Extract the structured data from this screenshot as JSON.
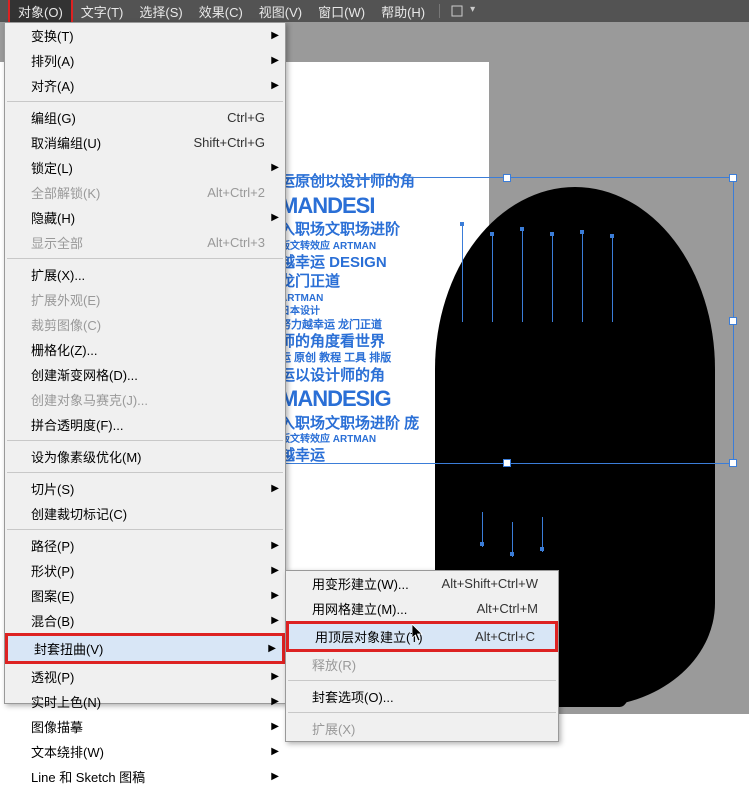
{
  "menubar": {
    "items": [
      "对象(O)",
      "文字(T)",
      "选择(S)",
      "效果(C)",
      "视图(V)",
      "窗口(W)",
      "帮助(H)"
    ]
  },
  "bg_text": {
    "l1": "运原创以设计师的角",
    "l2": "MANDESI",
    "l3": "入职场文职场进阶",
    "l4": "版文转效应 ARTMAN",
    "l5": "越幸运 DESIGN",
    "l6": "龙门正道",
    "l7": "ARTMAN",
    "l8": "日本设计",
    "l9": "努力越幸运 龙门正道",
    "l10": "师的角度看世界",
    "l11": "运 原创 教程 工具 排版",
    "l12": "运以设计师的角",
    "l13": "MANDESIG",
    "l14": "入职场文职场进阶 庞",
    "l15": "版文转效应 ARTMAN",
    "l16": "越幸运"
  },
  "main_menu": [
    {
      "label": "变换(T)",
      "sub": true
    },
    {
      "label": "排列(A)",
      "sub": true
    },
    {
      "label": "对齐(A)",
      "sub": true
    },
    {
      "sep": true
    },
    {
      "label": "编组(G)",
      "sc": "Ctrl+G"
    },
    {
      "label": "取消编组(U)",
      "sc": "Shift+Ctrl+G"
    },
    {
      "label": "锁定(L)",
      "sub": true
    },
    {
      "label": "全部解锁(K)",
      "sc": "Alt+Ctrl+2",
      "disabled": true
    },
    {
      "label": "隐藏(H)",
      "sub": true
    },
    {
      "label": "显示全部",
      "sc": "Alt+Ctrl+3",
      "disabled": true
    },
    {
      "sep": true
    },
    {
      "label": "扩展(X)..."
    },
    {
      "label": "扩展外观(E)",
      "disabled": true
    },
    {
      "label": "裁剪图像(C)",
      "disabled": true
    },
    {
      "label": "栅格化(Z)..."
    },
    {
      "label": "创建渐变网格(D)..."
    },
    {
      "label": "创建对象马赛克(J)...",
      "disabled": true
    },
    {
      "label": "拼合透明度(F)..."
    },
    {
      "sep": true
    },
    {
      "label": "设为像素级优化(M)"
    },
    {
      "sep": true
    },
    {
      "label": "切片(S)",
      "sub": true
    },
    {
      "label": "创建裁切标记(C)"
    },
    {
      "sep": true
    },
    {
      "label": "路径(P)",
      "sub": true
    },
    {
      "label": "形状(P)",
      "sub": true
    },
    {
      "label": "图案(E)",
      "sub": true
    },
    {
      "label": "混合(B)",
      "sub": true
    },
    {
      "label": "封套扭曲(V)",
      "sub": true,
      "hl": true,
      "red": true
    },
    {
      "label": "透视(P)",
      "sub": true
    },
    {
      "label": "实时上色(N)",
      "sub": true
    },
    {
      "label": "图像描摹",
      "sub": true
    },
    {
      "label": "文本绕排(W)",
      "sub": true
    },
    {
      "label": "Line 和 Sketch 图稿",
      "sub": true
    }
  ],
  "sub_menu": [
    {
      "label": "用变形建立(W)...",
      "sc": "Alt+Shift+Ctrl+W"
    },
    {
      "label": "用网格建立(M)...",
      "sc": "Alt+Ctrl+M"
    },
    {
      "label": "用顶层对象建立(T)",
      "sc": "Alt+Ctrl+C",
      "hl": true,
      "red": true
    },
    {
      "label": "释放(R)",
      "disabled": true
    },
    {
      "sep": true
    },
    {
      "label": "封套选项(O)..."
    },
    {
      "sep": true
    },
    {
      "label": "扩展(X)",
      "disabled": true
    }
  ]
}
